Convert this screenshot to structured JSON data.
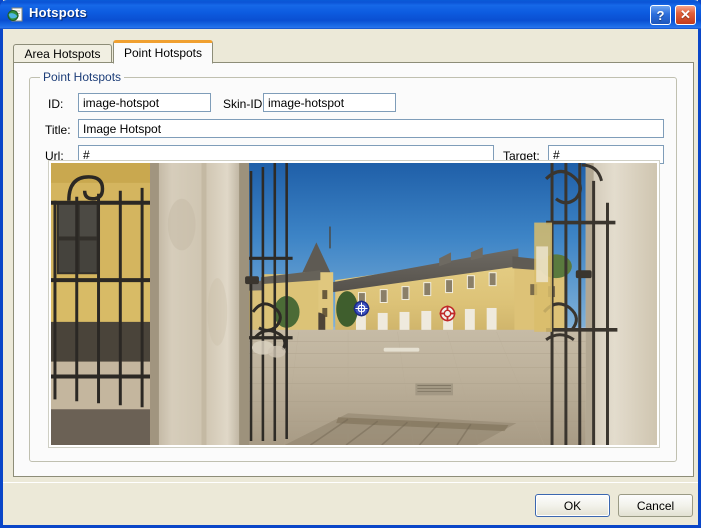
{
  "window": {
    "title": "Hotspots",
    "icon": "globe-page-icon",
    "help_label": "?",
    "close_label": "✕",
    "border_color": "#0a46c8",
    "titlebar_color": "#0d5ce0",
    "dialog_bg": "#ece9d8"
  },
  "tabs": [
    {
      "label": "Area Hotspots",
      "active": false
    },
    {
      "label": "Point Hotspots",
      "active": true
    }
  ],
  "group": {
    "legend": "Point Hotspots",
    "legend_color": "#1c3d78"
  },
  "fields": {
    "id": {
      "label": "ID:",
      "value": "image-hotspot"
    },
    "skin_id": {
      "label": "Skin-ID:",
      "value": "image-hotspot"
    },
    "title": {
      "label": "Title:",
      "value": "Image Hotspot"
    },
    "url": {
      "label": "Url:",
      "value": "#"
    },
    "target": {
      "label": "Target:",
      "value": "#"
    }
  },
  "preview": {
    "name": "panorama-preview",
    "description": "Courtyard panorama seen through an open wrought-iron gate",
    "hotspots": [
      {
        "name": "hotspot-marker-blue",
        "color": "#2a3fae",
        "state": "normal"
      },
      {
        "name": "hotspot-marker-red",
        "color": "#d03030",
        "state": "selected"
      }
    ]
  },
  "buttons": {
    "ok": "OK",
    "cancel": "Cancel"
  }
}
